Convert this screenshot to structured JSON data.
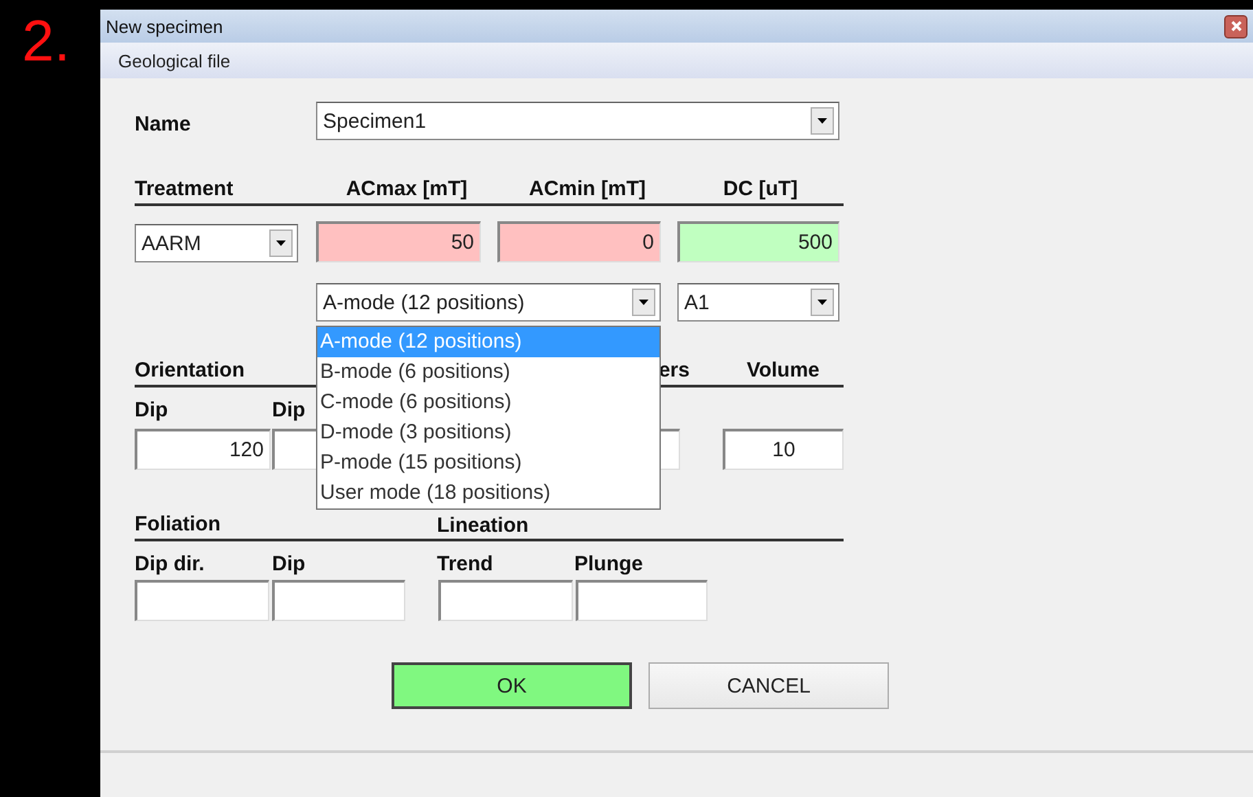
{
  "annotation": "2.",
  "window": {
    "title": "New specimen"
  },
  "menu": [
    {
      "label": "Geological file"
    }
  ],
  "name": {
    "label": "Name",
    "value": "Specimen1"
  },
  "treatment": {
    "headers": [
      "Treatment",
      "ACmax [mT]",
      "ACmin [mT]",
      "DC [uT]"
    ],
    "treatment_value": "AARM",
    "fields": [
      {
        "value": "50",
        "color": "#ffc0c0"
      },
      {
        "value": "0",
        "color": "#ffc0c0"
      },
      {
        "value": "500",
        "color": "#c0ffc0"
      }
    ],
    "mode_value": "A-mode (12 positions)",
    "position_value": "A1"
  },
  "mode_dropdown": {
    "options": [
      {
        "label": "A-mode (12 positions)",
        "selected": true
      },
      {
        "label": "B-mode (6 positions)",
        "selected": false
      },
      {
        "label": "C-mode (6 positions)",
        "selected": false
      },
      {
        "label": "D-mode (3 positions)",
        "selected": false
      },
      {
        "label": "P-mode (15 positions)",
        "selected": false
      },
      {
        "label": "User mode (18 positions)",
        "selected": false
      }
    ]
  },
  "orientation": {
    "title": "Orientation",
    "partial_header": "ers",
    "volume_label": "Volume",
    "labels": [
      "Dip",
      "Dip"
    ],
    "dip_value": "120",
    "volume_value": "10"
  },
  "foliation": {
    "title": "Foliation",
    "labels": [
      "Dip dir.",
      "Dip"
    ]
  },
  "lineation": {
    "title": "Lineation",
    "labels": [
      "Trend",
      "Plunge"
    ]
  },
  "buttons": [
    {
      "label": "OK",
      "kind": "primary"
    },
    {
      "label": "CANCEL",
      "kind": "normal"
    }
  ]
}
